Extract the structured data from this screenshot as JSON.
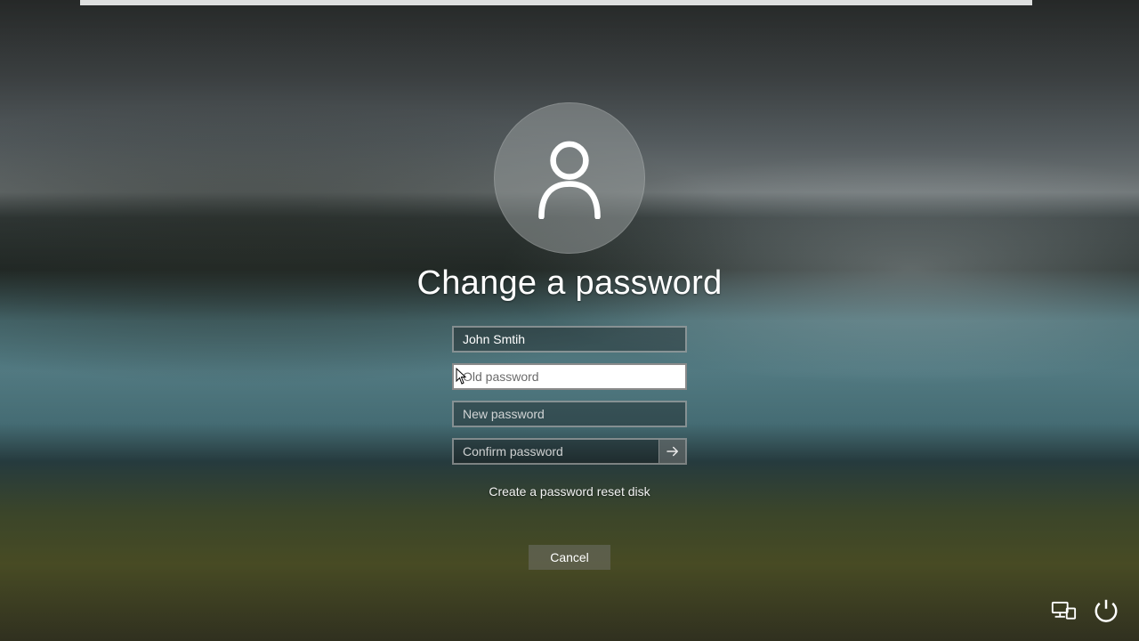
{
  "title": "Change a password",
  "username": "John Smtih",
  "fields": {
    "old_password_placeholder": "Old password",
    "new_password_placeholder": "New password",
    "confirm_password_placeholder": "Confirm password"
  },
  "link_reset_disk": "Create a password reset disk",
  "cancel_label": "Cancel",
  "icons": {
    "avatar": "user-icon",
    "submit": "arrow-right-icon",
    "network": "network-icon",
    "power": "power-icon"
  }
}
